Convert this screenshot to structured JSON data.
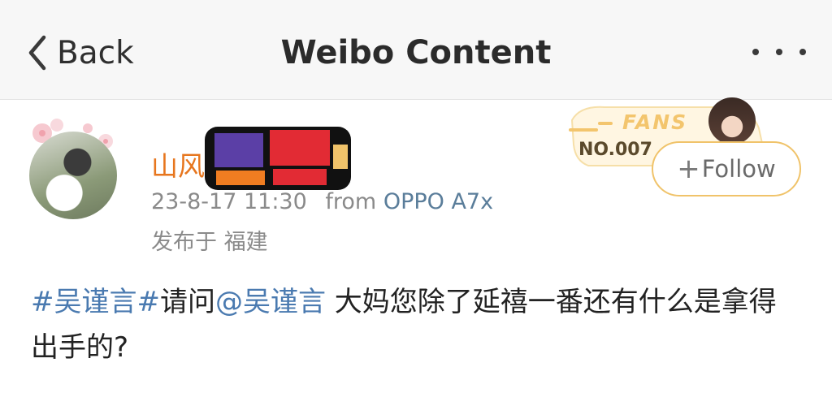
{
  "header": {
    "back_label": "Back",
    "title": "Weibo Content"
  },
  "user": {
    "name_visible": "山风",
    "time": "23-8-17 11:30",
    "from_prefix": "from",
    "device": "OPPO A7x",
    "location": "发布于 福建"
  },
  "badge": {
    "fans_label": "FANS",
    "number": "NO.007"
  },
  "follow_label": "Follow",
  "post": {
    "topic": "#吴谨言#",
    "text1": "请问",
    "mention": "@吴谨言",
    "text2": " 大妈您除了延禧一番还有什么是拿得出手的?"
  },
  "colors": {
    "username": "#e7761e",
    "link": "#4a7ab0",
    "follow_border": "#f0c36a"
  }
}
